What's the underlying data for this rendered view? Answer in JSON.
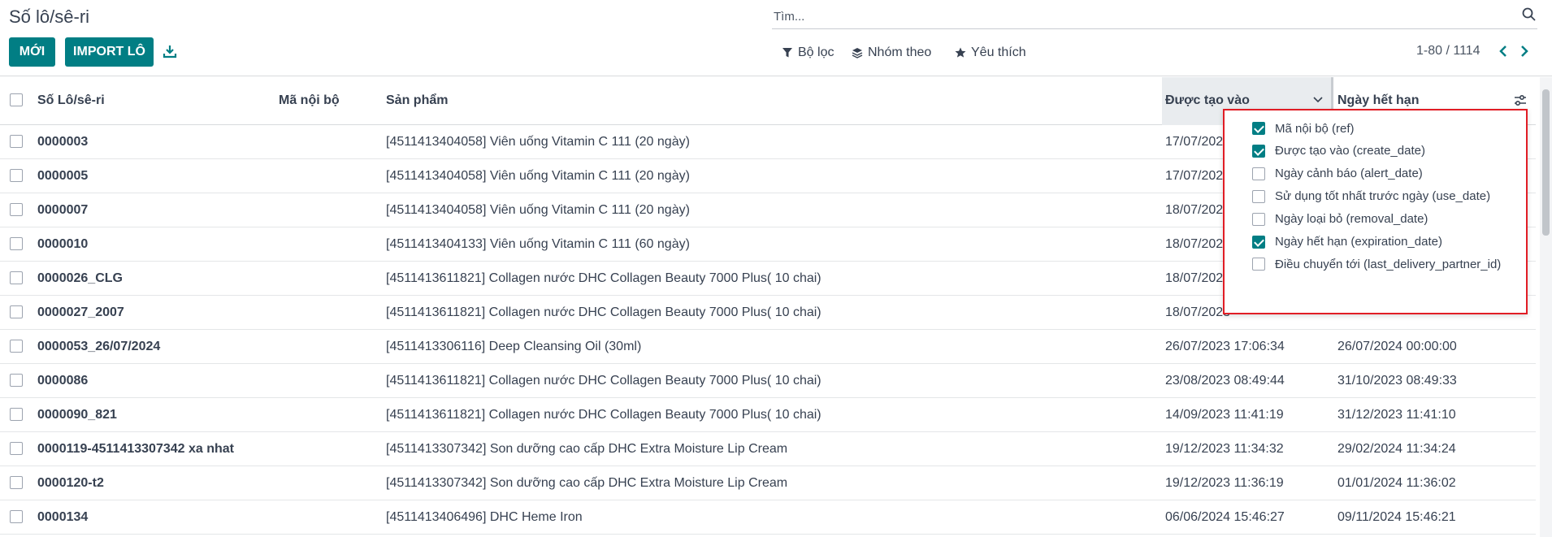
{
  "page": {
    "title": "Số lô/sê-ri"
  },
  "toolbar": {
    "new_label": "MỚI",
    "import_label": "IMPORT LÔ"
  },
  "search": {
    "placeholder": "Tìm..."
  },
  "filters": {
    "filter_label": "Bộ lọc",
    "group_label": "Nhóm theo",
    "favorites_label": "Yêu thích"
  },
  "pager": {
    "text": "1-80 / 1114"
  },
  "columns": {
    "lot": "Số Lô/sê-ri",
    "ref": "Mã nội bộ",
    "product": "Sản phẩm",
    "created": "Được tạo vào",
    "expiration": "Ngày hết hạn"
  },
  "rows": [
    {
      "lot": "0000003",
      "product": "[4511413404058] Viên uống Vitamin C 111 (20 ngày)",
      "created": "17/07/2023",
      "expires": ""
    },
    {
      "lot": "0000005",
      "product": "[4511413404058] Viên uống Vitamin C 111 (20 ngày)",
      "created": "17/07/2023",
      "expires": ""
    },
    {
      "lot": "0000007",
      "product": "[4511413404058] Viên uống Vitamin C 111 (20 ngày)",
      "created": "18/07/2023",
      "expires": ""
    },
    {
      "lot": "0000010",
      "product": "[4511413404133] Viên uống Vitamin C 111 (60 ngày)",
      "created": "18/07/2023",
      "expires": ""
    },
    {
      "lot": "0000026_CLG",
      "product": "[4511413611821] Collagen nước DHC Collagen Beauty 7000 Plus( 10 chai)",
      "created": "18/07/2023",
      "expires": ""
    },
    {
      "lot": "0000027_2007",
      "product": "[4511413611821] Collagen nước DHC Collagen Beauty 7000 Plus( 10 chai)",
      "created": "18/07/2023",
      "expires": ""
    },
    {
      "lot": "0000053_26/07/2024",
      "product": "[4511413306116] Deep Cleansing Oil (30ml)",
      "created": "26/07/2023 17:06:34",
      "expires": "26/07/2024 00:00:00"
    },
    {
      "lot": "0000086",
      "product": "[4511413611821] Collagen nước DHC Collagen Beauty 7000 Plus( 10 chai)",
      "created": "23/08/2023 08:49:44",
      "expires": "31/10/2023 08:49:33"
    },
    {
      "lot": "0000090_821",
      "product": "[4511413611821] Collagen nước DHC Collagen Beauty 7000 Plus( 10 chai)",
      "created": "14/09/2023 11:41:19",
      "expires": "31/12/2023 11:41:10"
    },
    {
      "lot": "0000119-4511413307342 xa nhat",
      "product": "[4511413307342] Son dưỡng cao cấp DHC Extra Moisture Lip Cream",
      "created": "19/12/2023 11:34:32",
      "expires": "29/02/2024 11:34:24"
    },
    {
      "lot": "0000120-t2",
      "product": "[4511413307342] Son dưỡng cao cấp DHC Extra Moisture Lip Cream",
      "created": "19/12/2023 11:36:19",
      "expires": "01/01/2024 11:36:02"
    },
    {
      "lot": "0000134",
      "product": "[4511413406496] DHC Heme Iron",
      "created": "06/06/2024 15:46:27",
      "expires": "09/11/2024 15:46:21"
    }
  ],
  "optional_columns": [
    {
      "label": "Mã nội bộ (ref)",
      "checked": true
    },
    {
      "label": "Được tạo vào (create_date)",
      "checked": true
    },
    {
      "label": "Ngày cảnh báo (alert_date)",
      "checked": false
    },
    {
      "label": "Sử dụng tốt nhất trước ngày (use_date)",
      "checked": false
    },
    {
      "label": "Ngày loại bỏ (removal_date)",
      "checked": false
    },
    {
      "label": "Ngày hết hạn (expiration_date)",
      "checked": true
    },
    {
      "label": "Điều chuyển tới (last_delivery_partner_id)",
      "checked": false
    }
  ],
  "colors": {
    "primary": "#017e84",
    "highlight_border": "#e11d25"
  }
}
